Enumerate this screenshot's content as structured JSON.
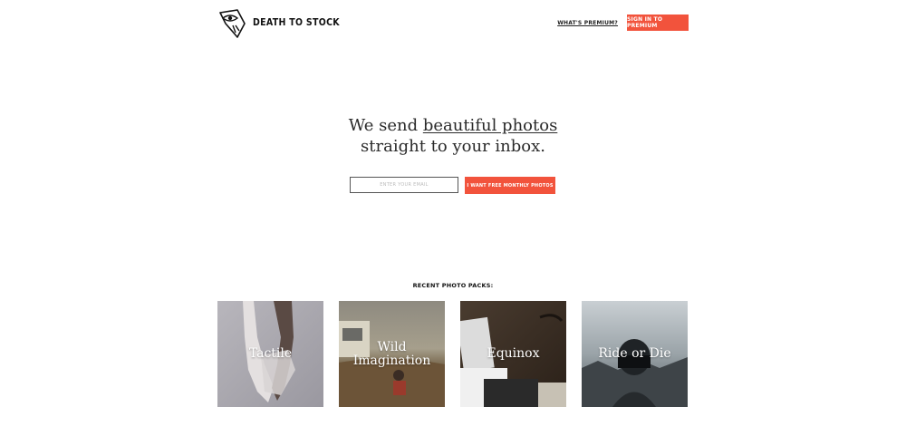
{
  "brand": {
    "name": "DEATH TO STOCK"
  },
  "nav": {
    "premium_link": "WHAT'S PREMIUM?",
    "signin_button": "SIGN IN TO PREMIUM"
  },
  "hero": {
    "line1_prefix": "We send ",
    "line1_highlight": "beautiful photos",
    "line2": "straight to your inbox."
  },
  "signup": {
    "email_placeholder": "ENTER YOUR EMAIL",
    "submit_label": "I WANT FREE MONTHLY PHOTOS"
  },
  "packs": {
    "title": "RECENT PHOTO PACKS:",
    "items": [
      {
        "label": "Tactile"
      },
      {
        "label": "Wild Imagination"
      },
      {
        "label": "Equinox"
      },
      {
        "label": "Ride or Die"
      }
    ]
  },
  "colors": {
    "accent": "#f2533c",
    "text": "#222222",
    "background": "#ffffff"
  }
}
